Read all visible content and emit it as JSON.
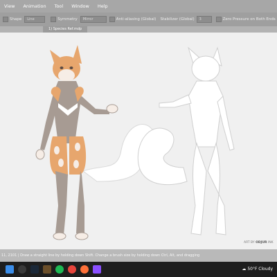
{
  "menu": [
    "View",
    "Animation",
    "Tool",
    "Window",
    "Help"
  ],
  "toolbar": {
    "shape_label": "Shape",
    "shape_value": "Line",
    "symmetry_label": "Symmetry",
    "symmetry_value": "Mirror",
    "antialias_label": "Anti-aliasing (Global)",
    "stabilizer_label": "Stabilizer (Global)",
    "stabilizer_value": "3",
    "zero_pressure_label": "Zero Pressure on Both Ends"
  },
  "tab": {
    "label": "1) Species Ref.mdp"
  },
  "canvas": {
    "credit_prefix": "ART BY",
    "credit_name": "ODJUR",
    "credit_suffix": "INK"
  },
  "status": {
    "text": "11, 2101 | Draw a straight line by holding down Shift. Change a brush size by holding down Ctrl, Alt, and dragging"
  },
  "taskbar": {
    "weather": "50°F Cloudy"
  },
  "colors": {
    "fur_orange": "#e7a66d",
    "fur_gray": "#a79b93",
    "lineart_bg": "#f0f0f0",
    "taskbar": "#1e1e1e"
  },
  "icons": [
    "windows-icon",
    "search-icon",
    "steam-icon",
    "minecraft-icon",
    "spotify-icon",
    "chrome-icon",
    "firefox-icon",
    "app-icon",
    "weather-icon"
  ]
}
